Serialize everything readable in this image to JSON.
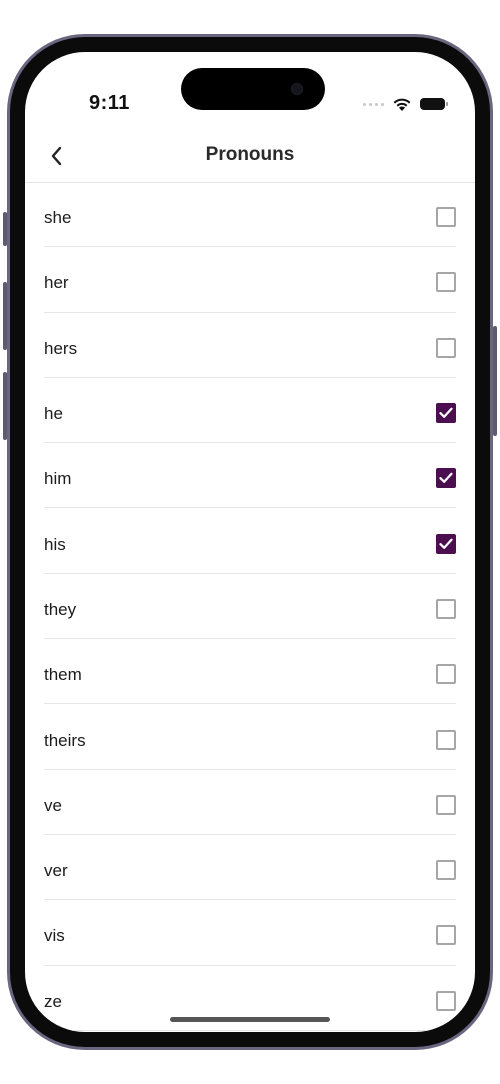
{
  "status_bar": {
    "time": "9:11"
  },
  "header": {
    "title": "Pronouns",
    "back_icon": "chevron-left-icon"
  },
  "colors": {
    "accent": "#4b0f4f",
    "checkbox_border": "#a6a6a6",
    "divider": "#e6e6e6"
  },
  "pronouns": [
    {
      "label": "she",
      "checked": false
    },
    {
      "label": "her",
      "checked": false
    },
    {
      "label": "hers",
      "checked": false
    },
    {
      "label": "he",
      "checked": true
    },
    {
      "label": "him",
      "checked": true
    },
    {
      "label": "his",
      "checked": true
    },
    {
      "label": "they",
      "checked": false
    },
    {
      "label": "them",
      "checked": false
    },
    {
      "label": "theirs",
      "checked": false
    },
    {
      "label": "ve",
      "checked": false
    },
    {
      "label": "ver",
      "checked": false
    },
    {
      "label": "vis",
      "checked": false
    },
    {
      "label": "ze",
      "checked": false
    }
  ]
}
